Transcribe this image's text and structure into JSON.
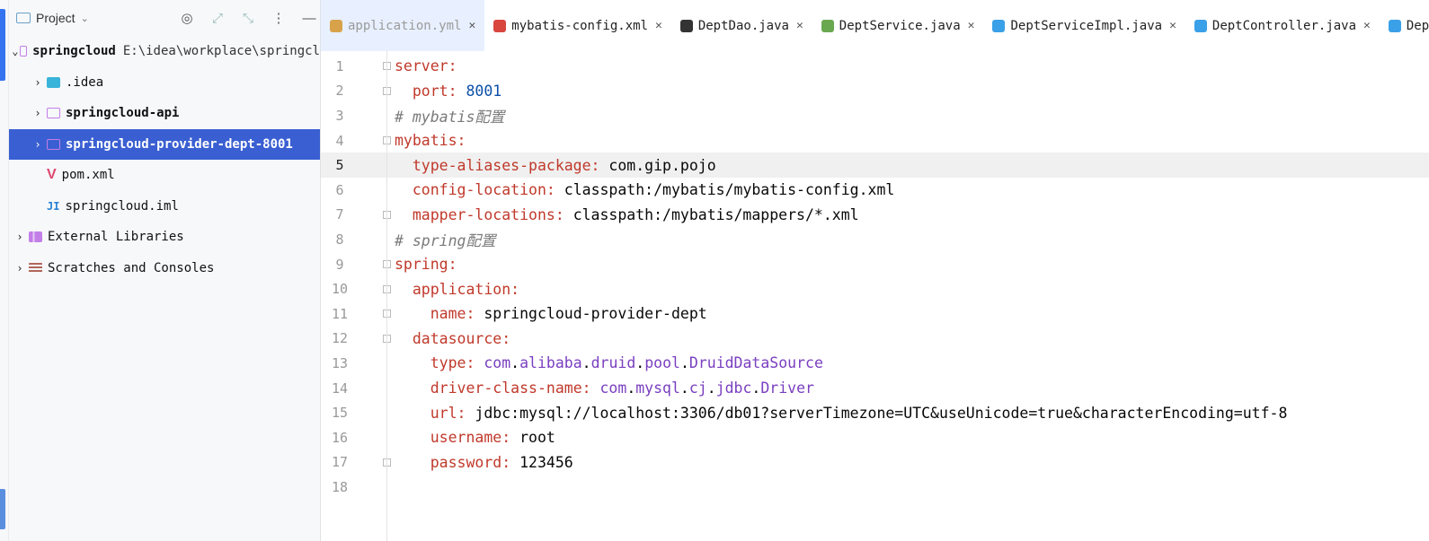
{
  "project_panel": {
    "title": "Project",
    "tree": [
      {
        "label": "springcloud",
        "path": "E:\\idea\\workplace\\springcl",
        "arrow": "⌄",
        "indent": 0,
        "icon": "folder-icon",
        "bold": true
      },
      {
        "label": ".idea",
        "arrow": "›",
        "indent": 1,
        "icon": "idea-folder-icon"
      },
      {
        "label": "springcloud-api",
        "arrow": "›",
        "indent": 1,
        "icon": "module-folder-icon",
        "bold": true
      },
      {
        "label": "springcloud-provider-dept-8001",
        "arrow": "›",
        "indent": 1,
        "icon": "module-folder-icon",
        "bold": true,
        "selected": true
      },
      {
        "label": "pom.xml",
        "arrow": "",
        "indent": 1,
        "icon": "maven-icon"
      },
      {
        "label": "springcloud.iml",
        "arrow": "",
        "indent": 1,
        "icon": "iml-icon"
      },
      {
        "label": "External Libraries",
        "arrow": "›",
        "indent": 0,
        "icon": "library-icon"
      },
      {
        "label": "Scratches and Consoles",
        "arrow": "›",
        "indent": 0,
        "icon": "scratch-icon"
      }
    ]
  },
  "tabs": [
    {
      "label": "application.yml",
      "icon": "yaml-icon",
      "color": "#d8a24b",
      "active": true
    },
    {
      "label": "mybatis-config.xml",
      "icon": "xml-icon",
      "color": "#d9463e"
    },
    {
      "label": "DeptDao.java",
      "icon": "mybatis-icon",
      "color": "#333333"
    },
    {
      "label": "DeptService.java",
      "icon": "interface-icon",
      "color": "#6aa84f"
    },
    {
      "label": "DeptServiceImpl.java",
      "icon": "class-icon",
      "color": "#3aa0e8"
    },
    {
      "label": "DeptController.java",
      "icon": "class-icon",
      "color": "#3aa0e8"
    },
    {
      "label": "Dept",
      "icon": "class-icon",
      "color": "#3aa0e8"
    }
  ],
  "editor": {
    "current_line": 5,
    "lines": [
      {
        "n": "1",
        "parts": [
          [
            "k",
            "server:"
          ]
        ],
        "fold": true
      },
      {
        "n": "2",
        "parts": [
          [
            "s",
            "  "
          ],
          [
            "k",
            "port: "
          ],
          [
            "v",
            "8001"
          ]
        ],
        "fold": true
      },
      {
        "n": "3",
        "parts": [
          [
            "c",
            "# mybatis配置"
          ]
        ]
      },
      {
        "n": "4",
        "parts": [
          [
            "k",
            "mybatis:"
          ]
        ],
        "fold": true
      },
      {
        "n": "5",
        "parts": [
          [
            "s",
            "  "
          ],
          [
            "k",
            "type-aliases-package: "
          ],
          [
            "s",
            "com.gip.pojo"
          ]
        ]
      },
      {
        "n": "6",
        "parts": [
          [
            "s",
            "  "
          ],
          [
            "k",
            "config-location: "
          ],
          [
            "s",
            "classpath:/mybatis/mybatis-config.xml"
          ]
        ]
      },
      {
        "n": "7",
        "parts": [
          [
            "s",
            "  "
          ],
          [
            "k",
            "mapper-locations: "
          ],
          [
            "s",
            "classpath:/mybatis/mappers/*.xml"
          ]
        ],
        "fold": true
      },
      {
        "n": "8",
        "parts": [
          [
            "c",
            "# spring配置"
          ]
        ]
      },
      {
        "n": "9",
        "parts": [
          [
            "k",
            "spring:"
          ]
        ],
        "fold": true
      },
      {
        "n": "10",
        "parts": [
          [
            "s",
            "  "
          ],
          [
            "k",
            "application:"
          ]
        ],
        "fold": true
      },
      {
        "n": "11",
        "parts": [
          [
            "s",
            "    "
          ],
          [
            "k",
            "name: "
          ],
          [
            "s",
            "springcloud-provider-dept"
          ]
        ],
        "fold": true
      },
      {
        "n": "12",
        "parts": [
          [
            "s",
            "  "
          ],
          [
            "k",
            "datasource:"
          ]
        ],
        "fold": true
      },
      {
        "n": "13",
        "parts": [
          [
            "s",
            "    "
          ],
          [
            "k",
            "type: "
          ],
          [
            "p",
            "com"
          ],
          [
            "s",
            "."
          ],
          [
            "p",
            "alibaba"
          ],
          [
            "s",
            "."
          ],
          [
            "p",
            "druid"
          ],
          [
            "s",
            "."
          ],
          [
            "p",
            "pool"
          ],
          [
            "s",
            "."
          ],
          [
            "p",
            "DruidDataSource"
          ]
        ]
      },
      {
        "n": "14",
        "parts": [
          [
            "s",
            "    "
          ],
          [
            "k",
            "driver-class-name: "
          ],
          [
            "p",
            "com"
          ],
          [
            "s",
            "."
          ],
          [
            "p",
            "mysql"
          ],
          [
            "s",
            "."
          ],
          [
            "p",
            "cj"
          ],
          [
            "s",
            "."
          ],
          [
            "p",
            "jdbc"
          ],
          [
            "s",
            "."
          ],
          [
            "p",
            "Driver"
          ]
        ]
      },
      {
        "n": "15",
        "parts": [
          [
            "s",
            "    "
          ],
          [
            "k",
            "url: "
          ],
          [
            "s",
            "jdbc:mysql://localhost:3306/db01?serverTimezone=UTC&useUnicode=true&characterEncoding=utf-8"
          ]
        ]
      },
      {
        "n": "16",
        "parts": [
          [
            "s",
            "    "
          ],
          [
            "k",
            "username: "
          ],
          [
            "s",
            "root"
          ]
        ]
      },
      {
        "n": "17",
        "parts": [
          [
            "s",
            "    "
          ],
          [
            "k",
            "password: "
          ],
          [
            "s",
            "123456"
          ]
        ],
        "fold": true
      },
      {
        "n": "18",
        "parts": []
      }
    ]
  }
}
